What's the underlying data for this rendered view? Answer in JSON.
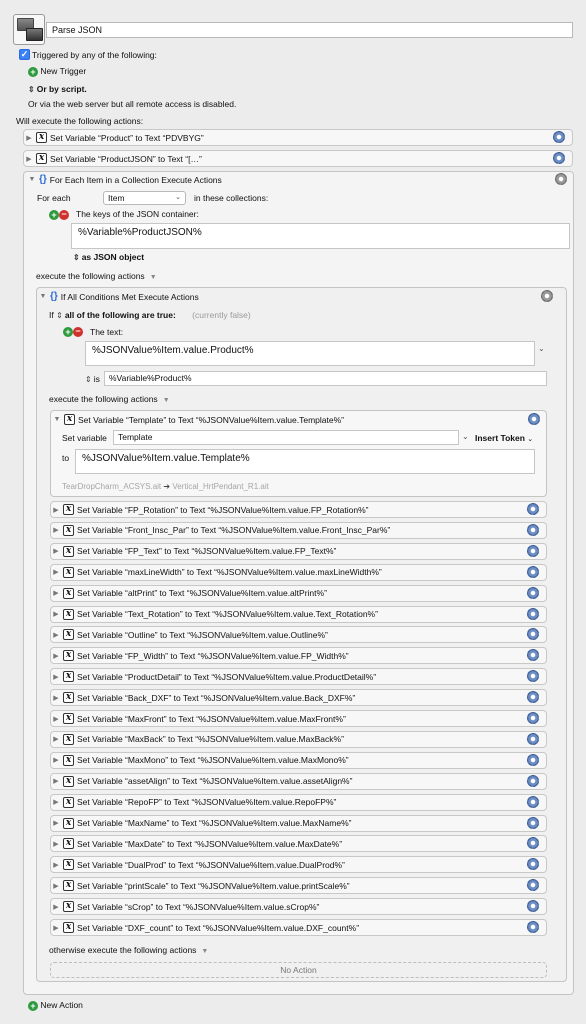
{
  "macro": {
    "name": "Parse JSON",
    "trigger_label": "Triggered by any of the following:",
    "new_trigger": "New Trigger",
    "or_by_script": "Or by script.",
    "web_server": "Or via the web server but all remote access is disabled.",
    "will_execute": "Will execute the following actions:"
  },
  "top_actions": [
    {
      "label": "Set Variable “Product” to Text “PDVBYG”"
    },
    {
      "label": "Set Variable “ProductJSON” to Text “[…”"
    }
  ],
  "foreach": {
    "title": "For Each Item in a Collection Execute Actions",
    "for_each_label": "For each",
    "variable": "Item",
    "in_collections": "in these collections:",
    "keys_label": "The keys of the JSON container:",
    "json_value": "%Variable%ProductJSON%",
    "as_json": "as JSON object",
    "execute_label": "execute the following actions"
  },
  "ifall": {
    "title": "If All Conditions Met Execute Actions",
    "if_label": "If",
    "all_label": "all of the following are true:",
    "currently": "(currently false)",
    "the_text": "The text:",
    "text_value": "%JSONValue%Item.value.Product%",
    "is_label": "is",
    "is_value": "%Variable%Product%",
    "execute_label": "execute the following actions",
    "otherwise_label": "otherwise execute the following actions",
    "no_action": "No Action"
  },
  "template_action": {
    "title": "Set Variable “Template” to Text “%JSONValue%Item.value.Template%”",
    "set_variable_label": "Set variable",
    "variable": "Template",
    "insert_token": "Insert Token",
    "to_label": "to",
    "value": "%JSONValue%Item.value.Template%",
    "preview_left": "TearDropCharm_ACSYS.ait",
    "preview_arrow": "➔",
    "preview_right": "Vertical_HrtPendant_R1.ait"
  },
  "set_actions": [
    "Set Variable “FP_Rotation” to Text “%JSONValue%Item.value.FP_Rotation%”",
    "Set Variable “Front_Insc_Par” to Text “%JSONValue%Item.value.Front_Insc_Par%”",
    "Set Variable “FP_Text” to Text “%JSONValue%Item.value.FP_Text%”",
    "Set Variable “maxLineWidth” to Text “%JSONValue%Item.value.maxLineWidth%”",
    "Set Variable “altPrint” to Text “%JSONValue%Item.value.altPrint%”",
    "Set Variable “Text_Rotation” to Text “%JSONValue%Item.value.Text_Rotation%”",
    "Set Variable “Outline” to Text “%JSONValue%Item.value.Outline%”",
    "Set Variable “FP_Width” to Text “%JSONValue%Item.value.FP_Width%”",
    "Set Variable “ProductDetail” to Text “%JSONValue%Item.value.ProductDetail%”",
    "Set Variable “Back_DXF” to Text “%JSONValue%Item.value.Back_DXF%”",
    "Set Variable “MaxFront” to Text “%JSONValue%Item.value.MaxFront%”",
    "Set Variable “MaxBack” to Text “%JSONValue%Item.value.MaxBack%”",
    "Set Variable “MaxMono” to Text “%JSONValue%Item.value.MaxMono%”",
    "Set Variable “assetAlign” to Text “%JSONValue%Item.value.assetAlign%”",
    "Set Variable “RepoFP” to Text “%JSONValue%Item.value.RepoFP%”",
    "Set Variable “MaxName” to Text “%JSONValue%Item.value.MaxName%”",
    "Set Variable “MaxDate” to Text “%JSONValue%Item.value.MaxDate%”",
    "Set Variable “DualProd” to Text “%JSONValue%Item.value.DualProd%”",
    "Set Variable “printScale” to Text “%JSONValue%Item.value.printScale%”",
    "Set Variable “sCrop” to Text “%JSONValue%Item.value.sCrop%”",
    "Set Variable “DXF_count” to Text “%JSONValue%Item.value.DXF_count%”"
  ],
  "new_action": "New Action",
  "icons": {
    "macro": "macro-windows-icon",
    "checkbox": "checkbox-checked-icon",
    "add": "plus-circle-icon",
    "remove": "minus-circle-icon",
    "disclosure": "disclosure-triangle-icon",
    "variable": "variable-x-icon",
    "gear": "gear-icon",
    "braces": "braces-icon"
  },
  "colors": {
    "accent": "#3b82f6",
    "add": "#2e9a3e",
    "remove": "#d0312d",
    "braces": "#2f6bd6"
  }
}
